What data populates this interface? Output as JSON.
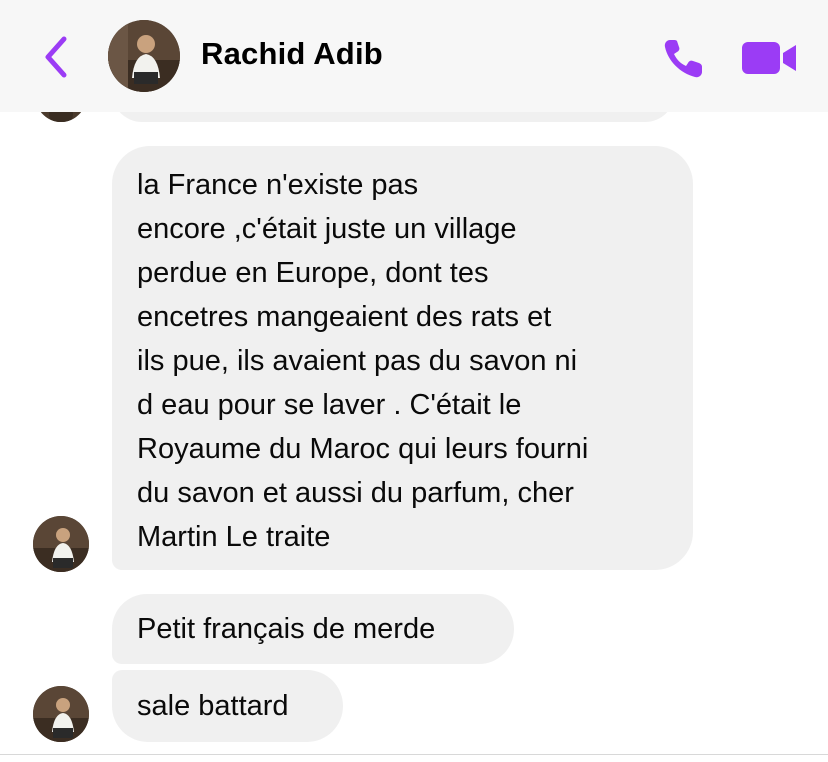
{
  "header": {
    "contact_name": "Rachid Adib",
    "back_icon": "chevron-left-icon",
    "call_icon": "phone-icon",
    "video_icon": "video-camera-icon"
  },
  "messages": [
    {
      "sender": "Rachid Adib",
      "lines": [
        "la France n'existe pas",
        "encore ,c'était juste un village",
        "perdue en Europe, dont tes",
        "encetres mangeaient des rats et",
        "ils pue, ils avaient pas du savon ni",
        "d eau pour se laver . C'était le",
        "Royaume du Maroc qui leurs fourni",
        "du savon et aussi du parfum, cher",
        "Martin Le traite"
      ]
    },
    {
      "sender": "Rachid Adib",
      "text": "Petit français de merde"
    },
    {
      "sender": "Rachid Adib",
      "text": "sale battard"
    }
  ],
  "colors": {
    "accent": "#9b3cf5",
    "header_bg": "#f7f7f7",
    "bubble_bg": "#f0f0f0",
    "text": "#0a0a0a"
  }
}
